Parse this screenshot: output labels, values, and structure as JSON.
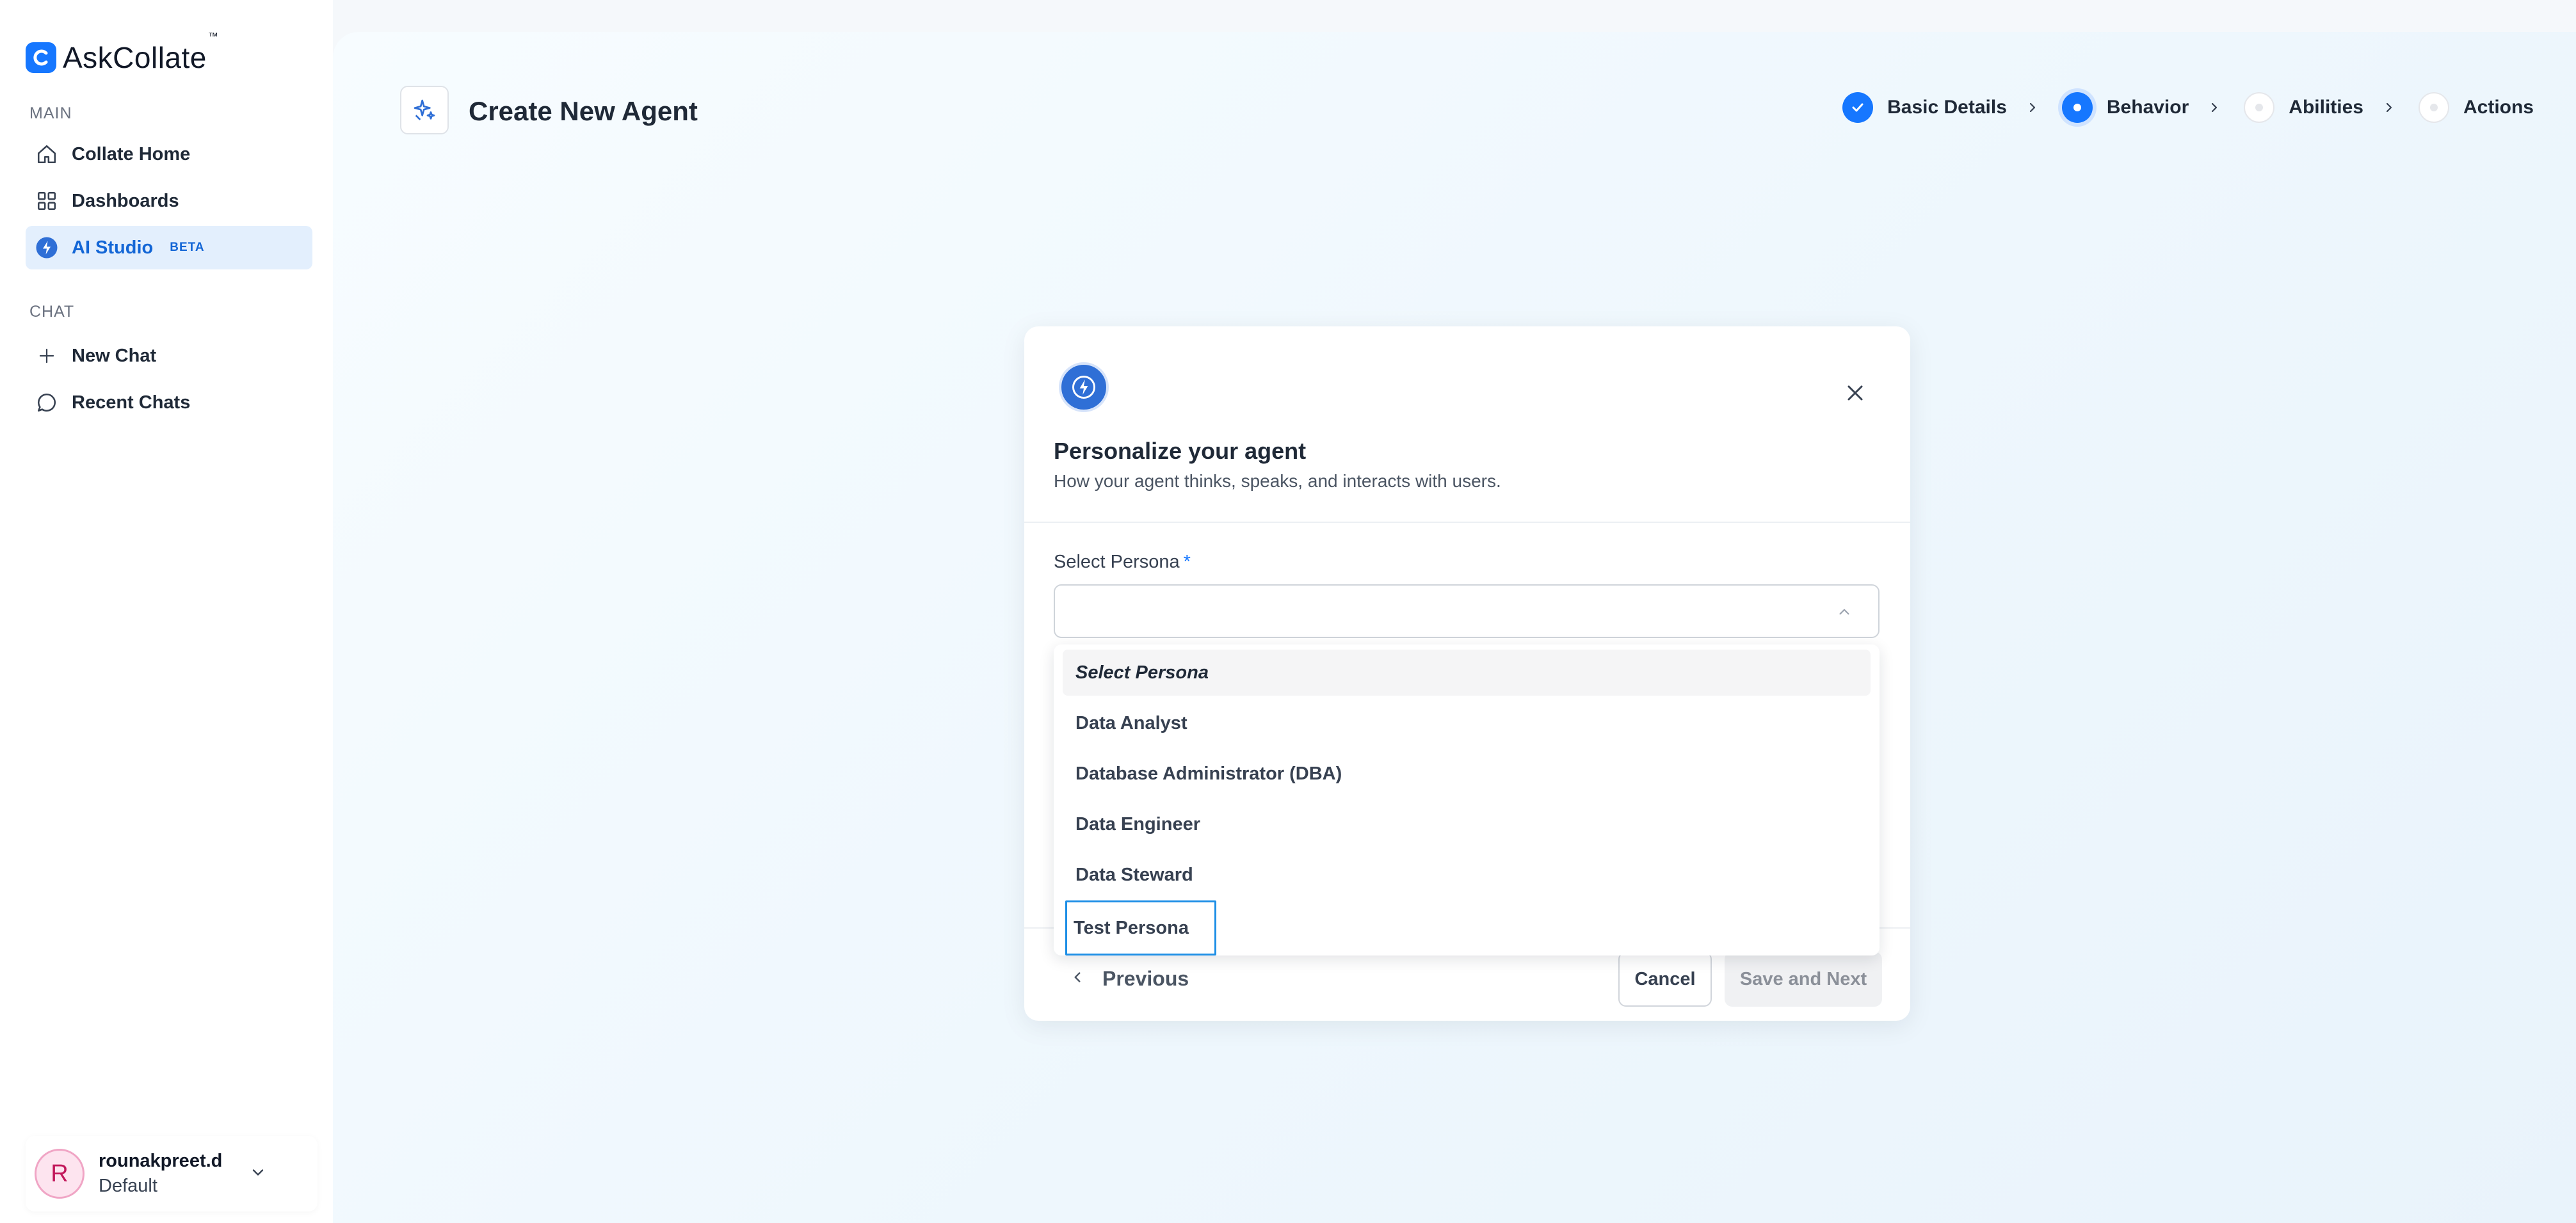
{
  "brand": {
    "name": "AskCollate",
    "trademark": "™"
  },
  "sidebar": {
    "main_label": "MAIN",
    "main_items": [
      {
        "label": "Collate Home",
        "icon": "home-icon"
      },
      {
        "label": "Dashboards",
        "icon": "grid-icon"
      },
      {
        "label": "AI Studio",
        "icon": "ai-studio-icon",
        "badge": "BETA",
        "active": true
      }
    ],
    "chat_label": "CHAT",
    "chat_items": [
      {
        "label": "New Chat",
        "icon": "plus-icon"
      },
      {
        "label": "Recent Chats",
        "icon": "chat-bubble-icon"
      }
    ]
  },
  "user": {
    "initial": "R",
    "name": "rounakpreet.d",
    "role": "Default"
  },
  "header": {
    "title": "Create New Agent",
    "icon": "sparkle-icon"
  },
  "stepper": {
    "steps": [
      {
        "label": "Basic Details",
        "state": "done"
      },
      {
        "label": "Behavior",
        "state": "active"
      },
      {
        "label": "Abilities",
        "state": "pending"
      },
      {
        "label": "Actions",
        "state": "pending"
      }
    ]
  },
  "modal": {
    "title": "Personalize your agent",
    "subtitle": "How your agent thinks, speaks, and interacts with users.",
    "field_label": "Select Persona",
    "required_mark": "*",
    "select_value": "",
    "options": [
      "Select Persona",
      "Data Analyst",
      "Database Administrator (DBA)",
      "Data Engineer",
      "Data Steward",
      "Test Persona"
    ],
    "previous_label": "Previous",
    "cancel_label": "Cancel",
    "save_label": "Save and Next"
  },
  "colors": {
    "accent": "#1677ff",
    "active_nav_bg": "#e3effd",
    "focus_outline": "#1e8fe6",
    "avatar_bg": "#fde4ef"
  }
}
